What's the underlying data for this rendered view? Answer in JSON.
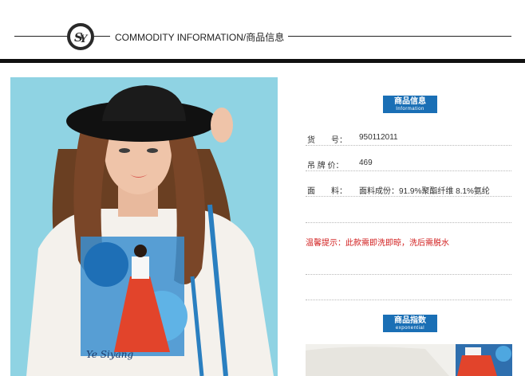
{
  "header": {
    "title": "COMMODITY INFORMATION/商品信息",
    "logo_letters": "SY"
  },
  "info_badge": {
    "cn": "商品信息",
    "en": "Information"
  },
  "details": [
    {
      "label": "货　　号：",
      "value": "950112011"
    },
    {
      "label": "吊 牌 价：",
      "value": "469"
    },
    {
      "label": "面　　料：",
      "value": "面料成份：91.9%聚酯纤维 8.1%氨纶"
    }
  ],
  "warning": "温馨提示：此款需即洗即晾，洗后需脱水",
  "index_badge": {
    "cn": "商品指数",
    "en": "exponential"
  },
  "shirt_text": "Ye Siyang",
  "colors": {
    "accent": "#1a6fb5",
    "warning": "#d11c1c",
    "photo_bg": "#8fd3e3"
  }
}
